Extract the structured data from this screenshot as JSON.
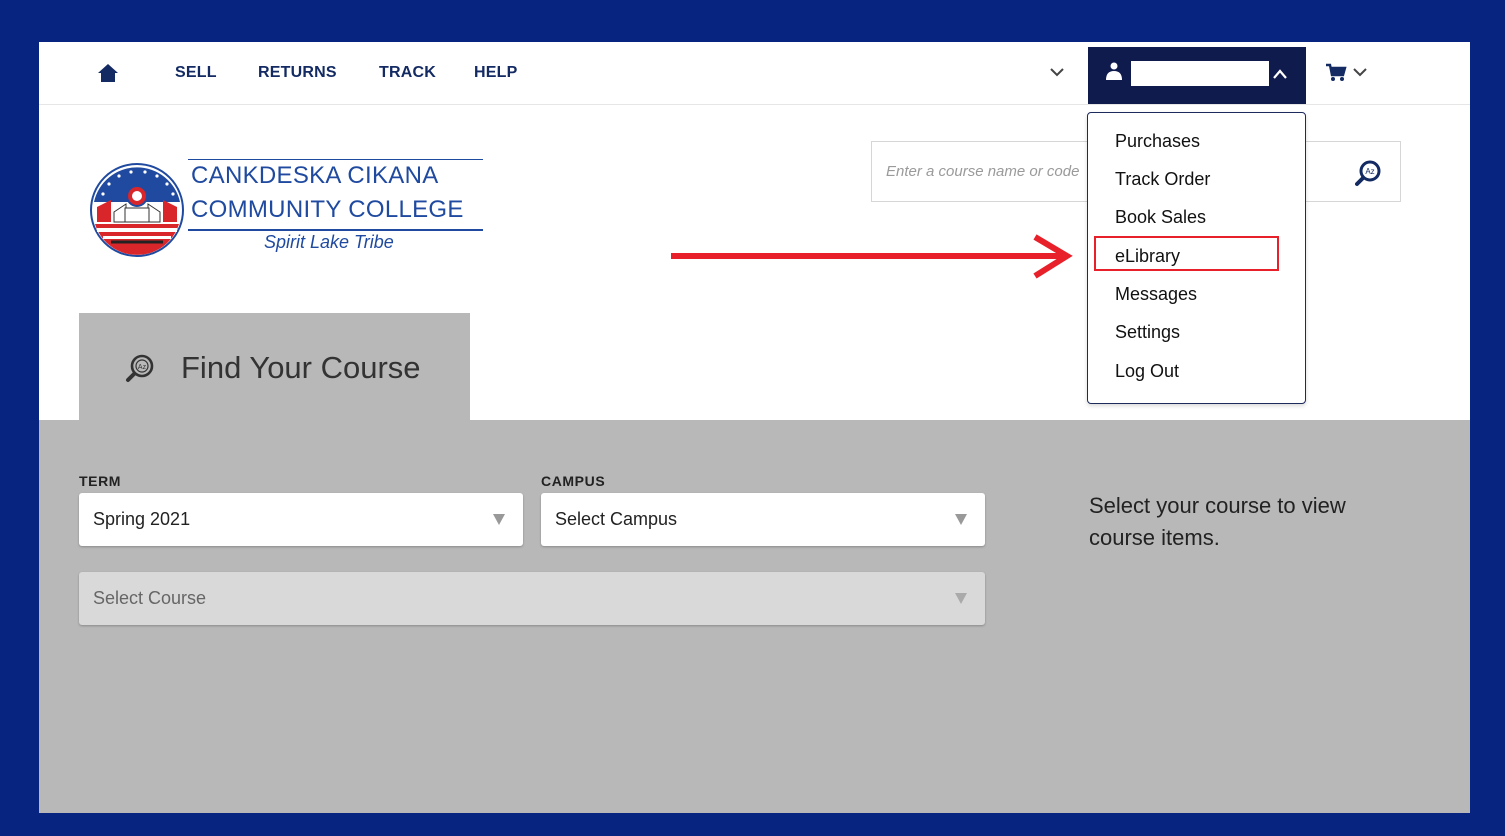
{
  "nav": {
    "links": [
      "SELL",
      "RETURNS",
      "TRACK",
      "HELP"
    ]
  },
  "account_menu": {
    "items": [
      "Purchases",
      "Track Order",
      "Book Sales",
      "eLibrary",
      "Messages",
      "Settings",
      "Log Out"
    ],
    "highlighted_item": "eLibrary"
  },
  "logo": {
    "line1": "CANKDESKA CIKANA",
    "line2": "COMMUNITY COLLEGE",
    "tagline": "Spirit Lake Tribe"
  },
  "search": {
    "placeholder": "Enter a course name or code"
  },
  "find_course": {
    "tab_label": "Find Your Course",
    "term_label": "TERM",
    "term_value": "Spring 2021",
    "campus_label": "CAMPUS",
    "campus_value": "Select Campus",
    "course_value": "Select Course",
    "help_text": "Select your course to view course items."
  },
  "colors": {
    "background_border": "#062480",
    "nav_text": "#132a63",
    "account_button": "#0f1a4d",
    "panel_gray": "#b8b8b8",
    "annotation_red": "#e8202a",
    "logo_blue": "#1f4aa0"
  }
}
